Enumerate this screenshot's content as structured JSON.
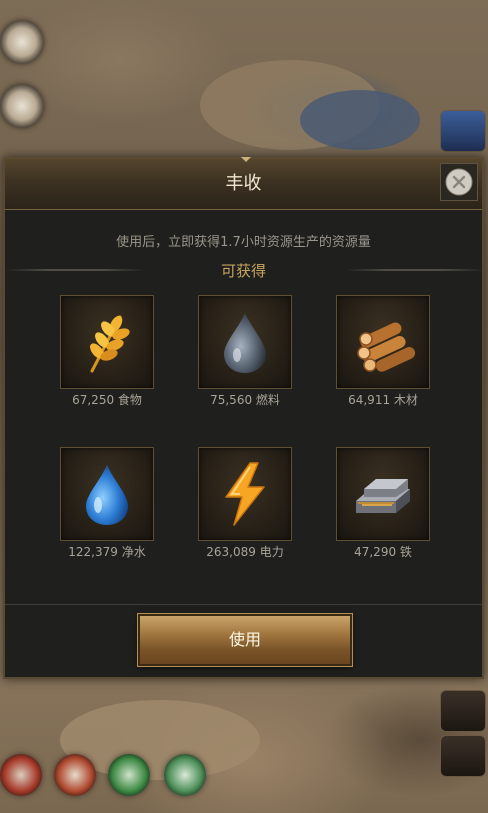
{
  "dialog": {
    "title": "丰收",
    "description": "使用后，立即获得1.7小时资源生产的资源量",
    "section_title": "可获得",
    "use_button_label": "使用",
    "close_icon": "close-icon"
  },
  "resources": [
    {
      "amount": "67,250",
      "name": "食物",
      "icon": "wheat-icon",
      "label": "67,250 食物"
    },
    {
      "amount": "75,560",
      "name": "燃料",
      "icon": "oil-drop-icon",
      "label": "75,560 燃料"
    },
    {
      "amount": "64,911",
      "name": "木材",
      "icon": "wood-logs-icon",
      "label": "64,911 木材"
    },
    {
      "amount": "122,379",
      "name": "净水",
      "icon": "water-drop-icon",
      "label": "122,379 净水"
    },
    {
      "amount": "263,089",
      "name": "电力",
      "icon": "lightning-icon",
      "label": "263,089 电力"
    },
    {
      "amount": "47,290",
      "name": "铁",
      "icon": "iron-ingot-icon",
      "label": "47,290 铁"
    }
  ],
  "colors": {
    "panel_bg": "#1f201d",
    "accent_gold": "#c7a462",
    "button_gold": "#a47a42"
  }
}
